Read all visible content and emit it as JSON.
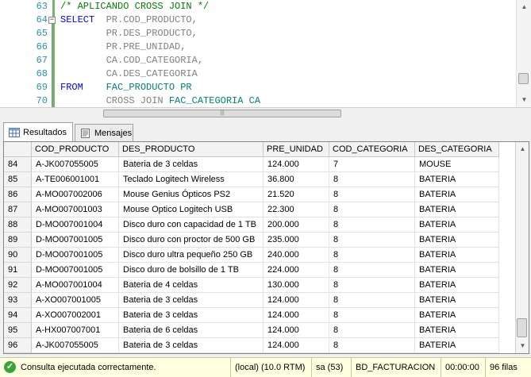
{
  "editor": {
    "lines": [
      {
        "num": "63",
        "segments": [
          {
            "cls": "cm",
            "text": "/* APLICANDO CROSS JOIN */"
          }
        ]
      },
      {
        "num": "64",
        "segments": [
          {
            "cls": "kw",
            "text": "SELECT  "
          },
          {
            "cls": "gr",
            "text": "PR.COD_PRODUCTO,"
          }
        ]
      },
      {
        "num": "65",
        "segments": [
          {
            "cls": "gr",
            "text": "        PR.DES_PRODUCTO,"
          }
        ]
      },
      {
        "num": "66",
        "segments": [
          {
            "cls": "gr",
            "text": "        PR.PRE_UNIDAD,"
          }
        ]
      },
      {
        "num": "67",
        "segments": [
          {
            "cls": "gr",
            "text": "        CA.COD_CATEGORIA,"
          }
        ]
      },
      {
        "num": "68",
        "segments": [
          {
            "cls": "gr",
            "text": "        CA.DES_CATEGORIA"
          }
        ]
      },
      {
        "num": "69",
        "segments": [
          {
            "cls": "kw",
            "text": "FROM    "
          },
          {
            "cls": "tl",
            "text": "FAC_PRODUCTO PR"
          }
        ]
      },
      {
        "num": "70",
        "segments": [
          {
            "cls": "gr",
            "text": "        CROSS JOIN "
          },
          {
            "cls": "tl",
            "text": "FAC_CATEGORIA CA"
          }
        ]
      }
    ]
  },
  "tabs": [
    {
      "label": "Resultados",
      "icon": "grid-icon",
      "active": true
    },
    {
      "label": "Mensajes",
      "icon": "messages-icon",
      "active": false
    }
  ],
  "results": {
    "columns": [
      "COD_PRODUCTO",
      "DES_PRODUCTO",
      "PRE_UNIDAD",
      "COD_CATEGORIA",
      "DES_CATEGORIA"
    ],
    "rows": [
      {
        "n": "84",
        "cells": [
          "A-JK007055005",
          "Bateria de 3 celdas",
          "124.000",
          "7",
          "MOUSE"
        ]
      },
      {
        "n": "85",
        "cells": [
          "A-TE006001001",
          "Teclado Logitech Wireless",
          "36.800",
          "8",
          "BATERIA"
        ]
      },
      {
        "n": "86",
        "cells": [
          "A-MO007002006",
          "Mouse Genius Ópticos PS2",
          "21.520",
          "8",
          "BATERIA"
        ]
      },
      {
        "n": "87",
        "cells": [
          "A-MO007001003",
          "Mouse Optico Logitech USB",
          "22.300",
          "8",
          "BATERIA"
        ]
      },
      {
        "n": "88",
        "cells": [
          "D-MO007001004",
          "Disco duro con capacidad de 1 TB",
          "200.000",
          "8",
          "BATERIA"
        ]
      },
      {
        "n": "89",
        "cells": [
          "D-MO007001005",
          "Disco duro con proctor de 500 GB",
          "235.000",
          "8",
          "BATERIA"
        ]
      },
      {
        "n": "90",
        "cells": [
          "D-MO007001005",
          "Disco duro ultra pequeño 250 GB",
          "240.000",
          "8",
          "BATERIA"
        ]
      },
      {
        "n": "91",
        "cells": [
          "D-MO007001005",
          "Disco duro de bolsillo de 1 TB",
          "224.000",
          "8",
          "BATERIA"
        ]
      },
      {
        "n": "92",
        "cells": [
          "A-MO007001004",
          "Bateria de 4 celdas",
          "130.000",
          "8",
          "BATERIA"
        ]
      },
      {
        "n": "93",
        "cells": [
          "A-XO007001005",
          "Bateria de 3 celdas",
          "124.000",
          "8",
          "BATERIA"
        ]
      },
      {
        "n": "94",
        "cells": [
          "A-XO007002001",
          "Bateria de 3 celdas",
          "124.000",
          "8",
          "BATERIA"
        ]
      },
      {
        "n": "95",
        "cells": [
          "A-HX007007001",
          "Bateria de 6 celdas",
          "124.000",
          "8",
          "BATERIA"
        ]
      },
      {
        "n": "96",
        "cells": [
          "A-JK007055005",
          "Bateria de 3 celdas",
          "124.000",
          "8",
          "BATERIA"
        ]
      }
    ]
  },
  "status": {
    "message": "Consulta ejecutada correctamente.",
    "server": "(local) (10.0 RTM)",
    "user": "sa (53)",
    "database": "BD_FACTURACION",
    "elapsed": "00:00:00",
    "rows": "96 filas",
    "icon": "success-check-icon"
  },
  "colors": {
    "keyword": "#0000ff",
    "comment": "#008000",
    "identifier": "#808080",
    "table": "#008080",
    "status_bg": "#ffffe1"
  }
}
